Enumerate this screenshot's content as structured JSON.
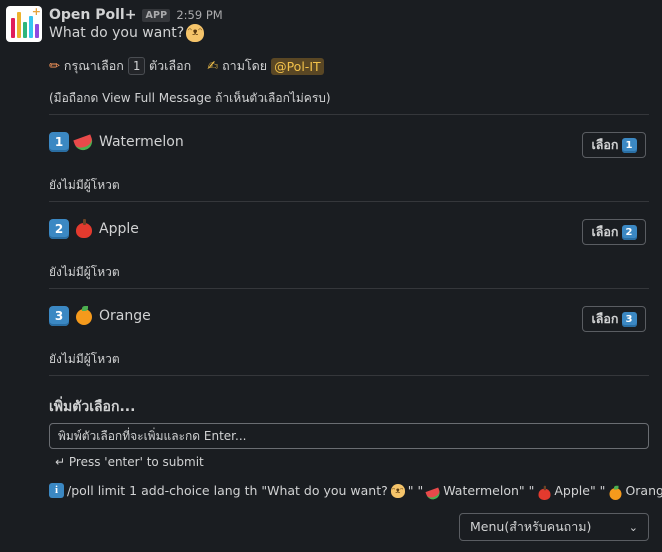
{
  "header": {
    "app_name": "Open Poll+",
    "badge": "APP",
    "time": "2:59 PM"
  },
  "poll": {
    "question": "What do you want?",
    "limit_prefix": "กรุณาเลือก",
    "limit_value": "1",
    "limit_suffix": "ตัวเลือก",
    "asked_by_label": "ถามโดย",
    "asked_by_mention": "@Pol-IT",
    "hint": "(มือถือกด View Full Message ถ้าเห็นตัวเลือกไม่ครบ)"
  },
  "options": [
    {
      "number": "1",
      "label": "Watermelon",
      "fruit_icon": "watermelon-icon",
      "button_label": "เลือก",
      "votes_text": "ยังไม่มีผู้โหวต"
    },
    {
      "number": "2",
      "label": "Apple",
      "fruit_icon": "apple-icon",
      "button_label": "เลือก",
      "votes_text": "ยังไม่มีผู้โหวต"
    },
    {
      "number": "3",
      "label": "Orange",
      "fruit_icon": "orange-icon",
      "button_label": "เลือก",
      "votes_text": "ยังไม่มีผู้โหวต"
    }
  ],
  "add_choice": {
    "title": "เพิ่มตัวเลือก...",
    "placeholder": "พิมพ์ตัวเลือกที่จะเพิ่มและกด Enter...",
    "submit_hint": "↵ Press 'enter' to submit"
  },
  "command": {
    "prefix": "/poll limit 1 add-choice lang th \"What do you want?",
    "part_q_end": "\" \"",
    "part_watermelon": " Watermelon\" \"",
    "part_apple": " Apple\" \"",
    "part_orange": " Orange\""
  },
  "menu": {
    "selected": "Menu(สำหรับคนถาม)"
  },
  "colors": {
    "background": "#1a1d21",
    "keycap": "#3b88c3",
    "mention_bg": "#5a4724",
    "mention_fg": "#f2c14a"
  }
}
